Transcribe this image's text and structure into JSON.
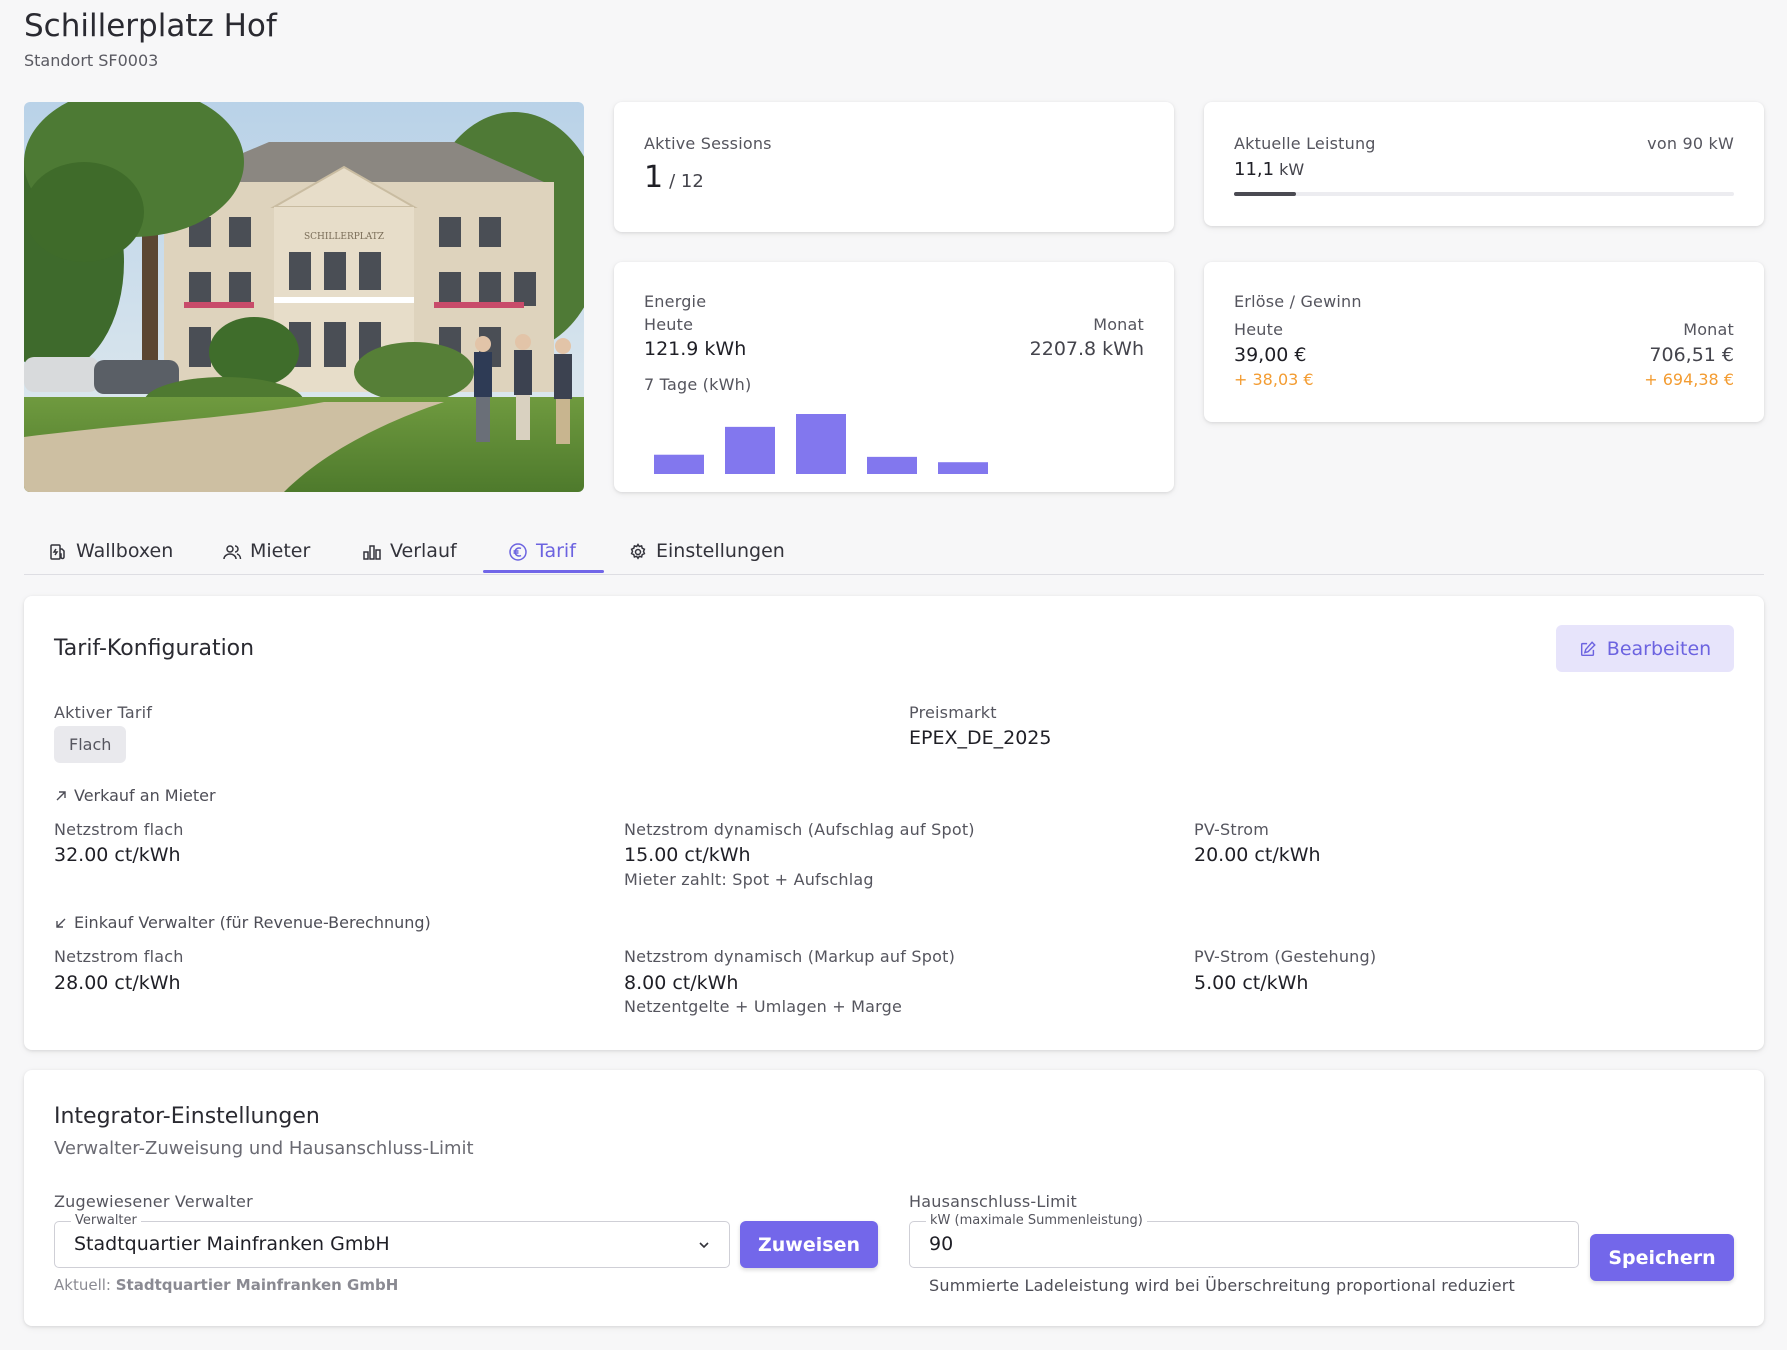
{
  "header": {
    "title": "Schillerplatz Hof",
    "subtitle": "Standort SF0003"
  },
  "hero": {
    "sign_text": "SCHILLERPLATZ"
  },
  "sessions": {
    "label": "Aktive Sessions",
    "active": "1",
    "total": "/ 12"
  },
  "power": {
    "label": "Aktuelle Leistung",
    "max_label": "von 90 kW",
    "value": "11,1",
    "unit": "kW",
    "fraction": 0.123
  },
  "energy": {
    "label": "Energie",
    "today_label": "Heute",
    "today_value": "121.9 kWh",
    "month_label": "Monat",
    "month_value": "2207.8 kWh",
    "week_label": "7 Tage (kWh)",
    "chart_color": "#8277ee"
  },
  "chart_data": {
    "type": "bar",
    "title": "7 Tage (kWh)",
    "categories": [
      "",
      "",
      "",
      "",
      ""
    ],
    "values": [
      18,
      44,
      56,
      16,
      11
    ],
    "ylim": [
      0,
      56
    ]
  },
  "revenue": {
    "label": "Erlöse / Gewinn",
    "today_label": "Heute",
    "today_value": "39,00 €",
    "today_profit": "+ 38,03 €",
    "month_label": "Monat",
    "month_value": "706,51 €",
    "month_profit": "+ 694,38 €",
    "profit_color": "#f39c32"
  },
  "tabs": [
    {
      "label": "Wallboxen",
      "icon": "ev-charger-icon"
    },
    {
      "label": "Mieter",
      "icon": "users-icon"
    },
    {
      "label": "Verlauf",
      "icon": "bar-chart-icon"
    },
    {
      "label": "Tarif",
      "icon": "euro-icon",
      "active": true
    },
    {
      "label": "Einstellungen",
      "icon": "gear-icon"
    }
  ],
  "tarif": {
    "title": "Tarif-Konfiguration",
    "edit_label": "Bearbeiten",
    "active_label": "Aktiver Tarif",
    "active_value": "Flach",
    "market_label": "Preismarkt",
    "market_value": "EPEX_DE_2025",
    "sale": {
      "heading": "Verkauf an Mieter",
      "flat_label": "Netzstrom flach",
      "flat_value": "32.00 ct/kWh",
      "dyn_label": "Netzstrom dynamisch (Aufschlag auf Spot)",
      "dyn_value": "15.00 ct/kWh",
      "dyn_note": "Mieter zahlt: Spot + Aufschlag",
      "pv_label": "PV-Strom",
      "pv_value": "20.00 ct/kWh"
    },
    "purchase": {
      "heading": "Einkauf Verwalter (für Revenue-Berechnung)",
      "flat_label": "Netzstrom flach",
      "flat_value": "28.00 ct/kWh",
      "dyn_label": "Netzstrom dynamisch (Markup auf Spot)",
      "dyn_value": "8.00 ct/kWh",
      "dyn_note": "Netzentgelte + Umlagen + Marge",
      "pv_label": "PV-Strom (Gestehung)",
      "pv_value": "5.00 ct/kWh"
    }
  },
  "integrator": {
    "title": "Integrator-Einstellungen",
    "subtitle": "Verwalter-Zuweisung und Hausanschluss-Limit",
    "manager_label": "Zugewiesener Verwalter",
    "manager_legend": "Verwalter",
    "manager_value": "Stadtquartier Mainfranken GmbH",
    "assign_label": "Zuweisen",
    "current_prefix": "Aktuell:",
    "current_value": "Stadtquartier Mainfranken GmbH",
    "limit_label": "Hausanschluss-Limit",
    "limit_legend": "kW (maximale Summenleistung)",
    "limit_value": "90",
    "limit_hint": "Summierte Ladeleistung wird bei Überschreitung proportional reduziert",
    "save_label": "Speichern"
  }
}
